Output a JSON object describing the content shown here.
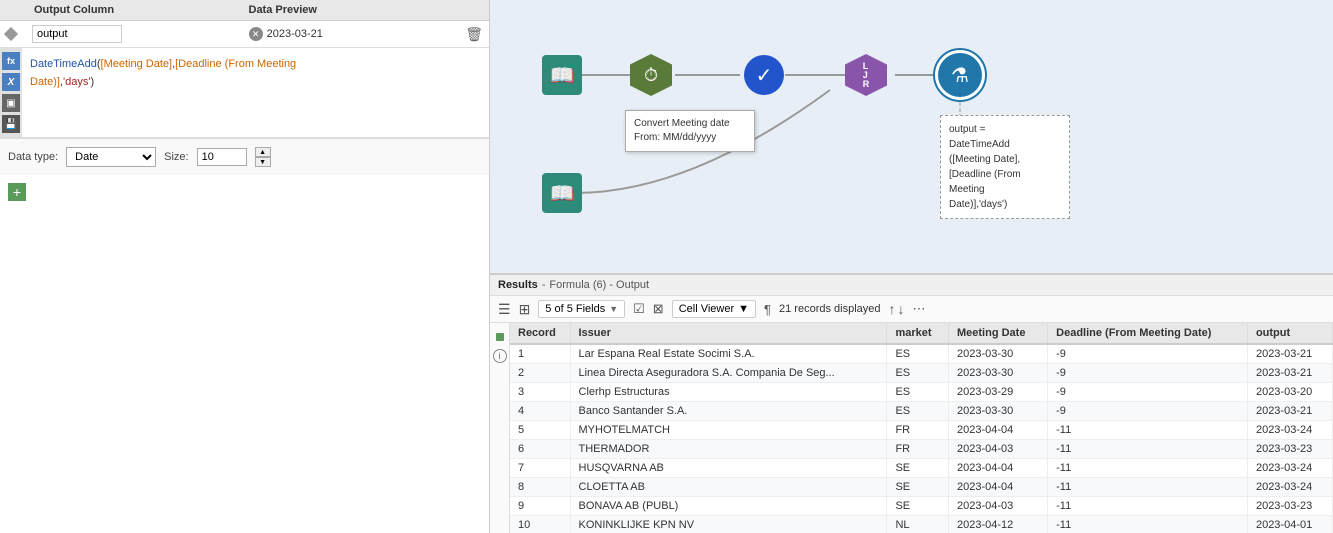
{
  "leftPanel": {
    "header": {
      "outputColumn": "Output Column",
      "dataPreview": "Data Preview"
    },
    "outputRow": {
      "fieldName": "output",
      "previewValue": "2023-03-21"
    },
    "formula": {
      "line1": "DateTimeAdd([Meeting Date],[Deadline (From Meeting",
      "line2": "Date)],'days')"
    },
    "sideIcons": {
      "formulaIcon": "fx",
      "varIcon": "X",
      "blockIcon": "▣",
      "saveIcon": "💾"
    },
    "dataType": {
      "label": "Data type:",
      "value": "Date",
      "sizeLabel": "Size:",
      "sizeValue": "10"
    },
    "addButton": "+"
  },
  "workflow": {
    "nodes": [
      {
        "id": "input1",
        "type": "book",
        "label": "",
        "color": "#2e8b7a"
      },
      {
        "id": "clock",
        "type": "clock",
        "label": "",
        "color": "#5a7a3a"
      },
      {
        "id": "checkmark",
        "type": "check",
        "label": "",
        "color": "#2255cc"
      },
      {
        "id": "join",
        "type": "join",
        "label": "",
        "color": "#8855aa"
      },
      {
        "id": "formula",
        "type": "formula",
        "label": "",
        "color": "#2277aa"
      },
      {
        "id": "input2",
        "type": "book",
        "label": "",
        "color": "#2e8b7a"
      }
    ],
    "tooltips": {
      "convertBox": "Convert Meeting date From: MM/dd/yyyy",
      "formulaBox": "output =\nDateTimeAdd\n([Meeting Date],\n[Deadline (From\nMeeting\nDate)],'days')"
    }
  },
  "results": {
    "headerLabel": "Results",
    "headerDetail": "Formula (6) - Output",
    "toolbar": {
      "fieldsCount": "5 of 5 Fields",
      "cellViewer": "Cell Viewer",
      "recordsDisplayed": "21 records displayed"
    },
    "columns": [
      "Record",
      "Issuer",
      "market",
      "Meeting Date",
      "Deadline (From Meeting Date)",
      "output"
    ],
    "rows": [
      {
        "record": "1",
        "issuer": "Lar Espana Real Estate Socimi S.A.",
        "market": "ES",
        "meetingDate": "2023-03-30",
        "deadline": "-9",
        "output": "2023-03-21"
      },
      {
        "record": "2",
        "issuer": "Linea Directa Aseguradora S.A. Compania De Seg...",
        "market": "ES",
        "meetingDate": "2023-03-30",
        "deadline": "-9",
        "output": "2023-03-21"
      },
      {
        "record": "3",
        "issuer": "Clerhp Estructuras",
        "market": "ES",
        "meetingDate": "2023-03-29",
        "deadline": "-9",
        "output": "2023-03-20"
      },
      {
        "record": "4",
        "issuer": "Banco Santander S.A.",
        "market": "ES",
        "meetingDate": "2023-03-30",
        "deadline": "-9",
        "output": "2023-03-21"
      },
      {
        "record": "5",
        "issuer": "MYHOTELMATCH",
        "market": "FR",
        "meetingDate": "2023-04-04",
        "deadline": "-11",
        "output": "2023-03-24"
      },
      {
        "record": "6",
        "issuer": "THERMADOR",
        "market": "FR",
        "meetingDate": "2023-04-03",
        "deadline": "-11",
        "output": "2023-03-23"
      },
      {
        "record": "7",
        "issuer": "HUSQVARNA AB",
        "market": "SE",
        "meetingDate": "2023-04-04",
        "deadline": "-11",
        "output": "2023-03-24"
      },
      {
        "record": "8",
        "issuer": "CLOETTA AB",
        "market": "SE",
        "meetingDate": "2023-04-04",
        "deadline": "-11",
        "output": "2023-03-24"
      },
      {
        "record": "9",
        "issuer": "BONAVA AB (PUBL)",
        "market": "SE",
        "meetingDate": "2023-04-03",
        "deadline": "-11",
        "output": "2023-03-23"
      },
      {
        "record": "10",
        "issuer": "KONINKLIJKE KPN NV",
        "market": "NL",
        "meetingDate": "2023-04-12",
        "deadline": "-11",
        "output": "2023-04-01"
      }
    ]
  }
}
